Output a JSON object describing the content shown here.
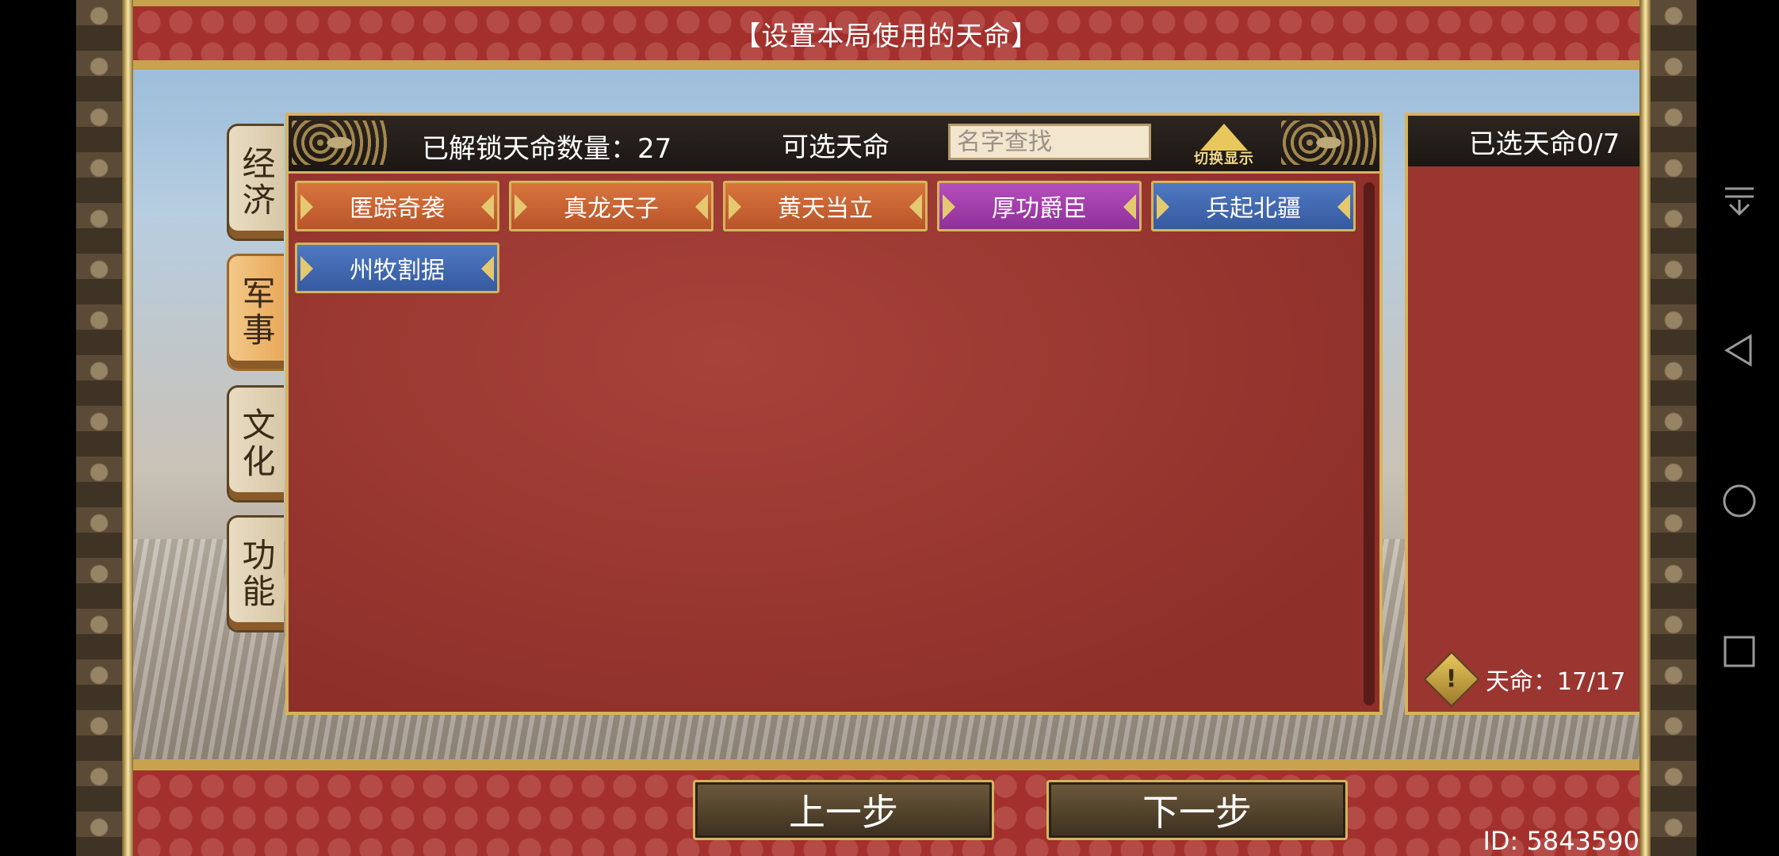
{
  "title": "【设置本局使用的天命】",
  "tabs": [
    {
      "label": "经济",
      "active": false
    },
    {
      "label": "军事",
      "active": true
    },
    {
      "label": "文化",
      "active": false
    },
    {
      "label": "功能",
      "active": false
    }
  ],
  "main_panel": {
    "unlock_text": "已解锁天命数量：27",
    "available_title": "可选天命",
    "search_placeholder": "名字查找",
    "toggle_label": "切换显示"
  },
  "destinies": [
    {
      "name": "匿踪奇袭",
      "color": "orange"
    },
    {
      "name": "真龙天子",
      "color": "orange"
    },
    {
      "name": "黄天当立",
      "color": "orange"
    },
    {
      "name": "厚功爵臣",
      "color": "purple"
    },
    {
      "name": "兵起北疆",
      "color": "blue"
    },
    {
      "name": "州牧割据",
      "color": "blue"
    }
  ],
  "right_panel": {
    "title": "已选天命0/7",
    "destiny_count": "天命：17/17",
    "warning_icon": "exclamation-diamond-icon"
  },
  "buttons": {
    "prev": "上一步",
    "next": "下一步"
  },
  "id_label": "ID: 5843590",
  "colors": {
    "frame_red": "#a3302c",
    "gold": "#d6b45c",
    "chip_orange": "#c9612f",
    "chip_purple": "#a23fad",
    "chip_blue": "#4268b0"
  },
  "system_nav": [
    "notification-pull-icon",
    "back-icon",
    "home-icon",
    "recents-icon"
  ]
}
